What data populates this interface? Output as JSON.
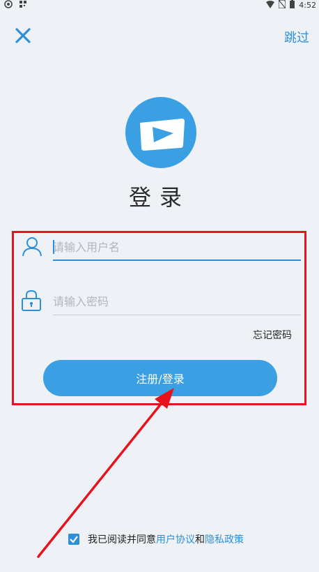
{
  "status_bar": {
    "time": "4:52"
  },
  "header": {
    "skip_label": "跳过"
  },
  "title": "登录",
  "username": {
    "placeholder": "请输入用户名"
  },
  "password": {
    "placeholder": "请输入密码"
  },
  "forgot_label": "忘记密码",
  "login_button_label": "注册/登录",
  "agreement": {
    "prefix": "我已阅读并同意",
    "user_agreement": "用户协议",
    "and": "和",
    "privacy_policy": "隐私政策",
    "checked": true
  },
  "colors": {
    "accent": "#2d8fd8",
    "button": "#3a9fe3",
    "highlight_box": "#e8121c",
    "background": "#eef2f6"
  }
}
